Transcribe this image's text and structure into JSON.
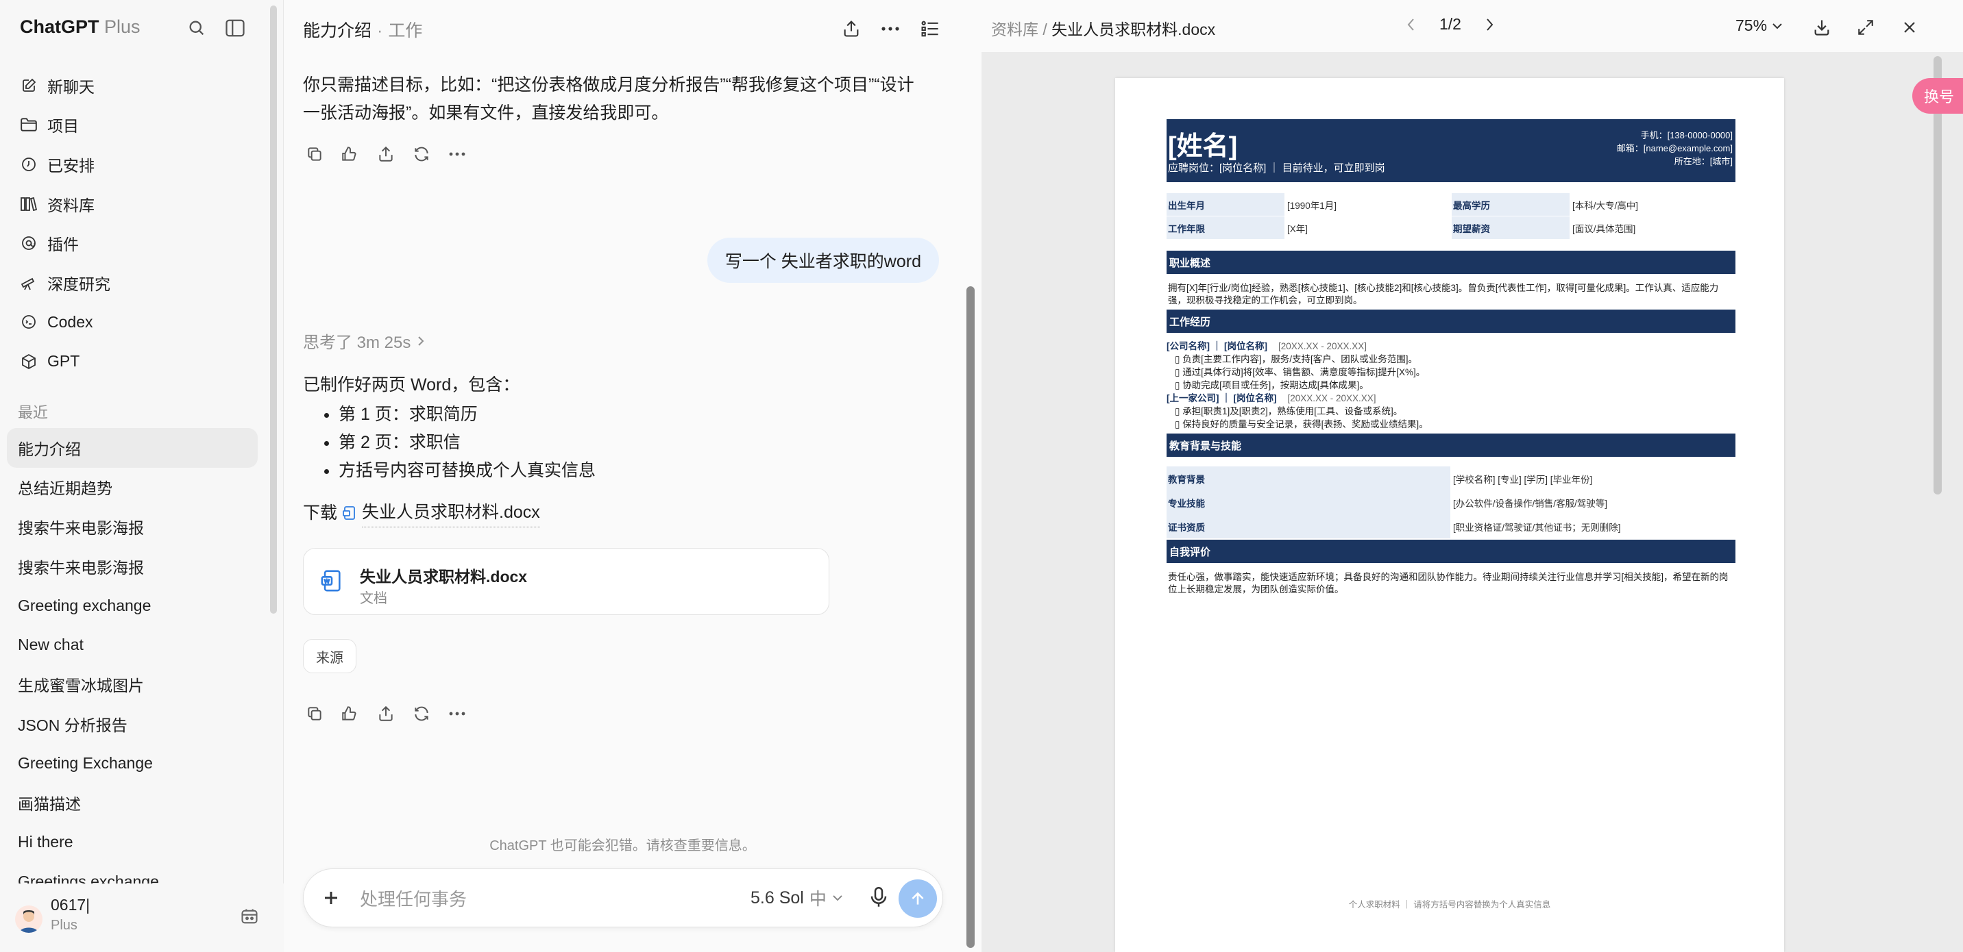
{
  "sidebar": {
    "brand": "ChatGPT",
    "brand_plan": "Plus",
    "nav": [
      {
        "label": "新聊天",
        "icon": "edit-icon"
      },
      {
        "label": "项目",
        "icon": "folder-icon"
      },
      {
        "label": "已安排",
        "icon": "clock-icon"
      },
      {
        "label": "资料库",
        "icon": "library-icon"
      },
      {
        "label": "插件",
        "icon": "plugin-icon"
      },
      {
        "label": "深度研究",
        "icon": "telescope-icon"
      },
      {
        "label": "Codex",
        "icon": "codex-icon"
      },
      {
        "label": "GPT",
        "icon": "cube-icon"
      }
    ],
    "recent_title": "最近",
    "recents": [
      "能力介绍",
      "总结近期趋势",
      "搜索牛来电影海报",
      "搜索牛来电影海报",
      "Greeting exchange",
      "New chat",
      "生成蜜雪冰城图片",
      "JSON 分析报告",
      "Greeting Exchange",
      "画猫描述",
      "Hi there",
      "Greetings exchange"
    ],
    "user": {
      "name": "0617|",
      "plan": "Plus"
    }
  },
  "chat": {
    "title": "能力介绍",
    "separator": "·",
    "project": "工作",
    "intro_line1": "你只需描述目标，比如：“把这份表格做成月度分析报告”“帮我修复这个项目”“设计",
    "intro_line2": "一张活动海报”。如果有文件，直接发给我即可。",
    "user_message": "写一个 失业者求职的word",
    "thinking": "思考了 3m 25s",
    "reply_intro": "已制作好两页 Word，包含：",
    "bullets": [
      "第 1 页：求职简历",
      "第 2 页：求职信",
      "方括号内容可替换成个人真实信息"
    ],
    "download_prefix": "下载",
    "download_link": "失业人员求职材料.docx",
    "file_card": {
      "name": "失业人员求职材料.docx",
      "type": "文档"
    },
    "sources": "来源",
    "disclaimer": "ChatGPT 也可能会犯错。请核查重要信息。",
    "composer": {
      "placeholder": "处理任何事务",
      "model": "5.6 Sol",
      "mode": "中"
    }
  },
  "viewer": {
    "breadcrumb_lib": "资料库",
    "breadcrumb_sep": "/",
    "breadcrumb_file": "失业人员求职材料.docx",
    "page_indicator": "1/2",
    "zoom": "75%",
    "swap_label": "换号",
    "doc": {
      "name": "[姓名]",
      "position_line": "应聘岗位：[岗位名称] ｜ 目前待业，可立即到岗",
      "phone": "手机：[138-0000-0000]",
      "email": "邮箱：[name@example.com]",
      "location": "所在地：[城市]",
      "info": [
        {
          "l1": "出生年月",
          "v1": "[1990年1月]",
          "l2": "最高学历",
          "v2": "[本科/大专/高中]"
        },
        {
          "l1": "工作年限",
          "v1": "[X年]",
          "l2": "期望薪资",
          "v2": "[面议/具体范围]"
        }
      ],
      "sec_summary": "职业概述",
      "summary": "拥有[X]年[行业/岗位]经验，熟悉[核心技能1]、[核心技能2]和[核心技能3]。曾负责[代表性工作]，取得[可量化成果]。工作认真、适应能力强，现积极寻找稳定的工作机会，可立即到岗。",
      "sec_work": "工作经历",
      "jobs": [
        {
          "title": "[公司名称] ｜ [岗位名称]",
          "date": "[20XX.XX - 20XX.XX]",
          "bullets": [
            "负责[主要工作内容]，服务/支持[客户、团队或业务范围]。",
            "通过[具体行动]将[效率、销售额、满意度等指标]提升[X%]。",
            "协助完成[项目或任务]，按期达成[具体成果]。"
          ]
        },
        {
          "title": "[上一家公司] ｜ [岗位名称]",
          "date": "[20XX.XX - 20XX.XX]",
          "bullets": [
            "承担[职责1]及[职责2]，熟练使用[工具、设备或系统]。",
            "保持良好的质量与安全记录，获得[表扬、奖励或业绩结果]。"
          ]
        }
      ],
      "sec_edu": "教育背景与技能",
      "edu": [
        {
          "label": "教育背景",
          "value": "[学校名称] [专业] [学历] [毕业年份]"
        },
        {
          "label": "专业技能",
          "value": "[办公软件/设备操作/销售/客服/驾驶等]"
        },
        {
          "label": "证书资质",
          "value": "[职业资格证/驾驶证/其他证书；无则删除]"
        }
      ],
      "sec_self": "自我评价",
      "self": "责任心强，做事踏实，能快速适应新环境；具备良好的沟通和团队协作能力。待业期间持续关注行业信息并学习[相关技能]，希望在新的岗位上长期稳定发展，为团队创造实际价值。",
      "footer": "个人求职材料 ｜ 请将方括号内容替换为个人真实信息"
    }
  },
  "colors": {
    "navy": "#1b3560",
    "accent_blue": "#2f7de1",
    "send_blue": "#9cc4f5",
    "swap_pink": "#f4709a"
  }
}
